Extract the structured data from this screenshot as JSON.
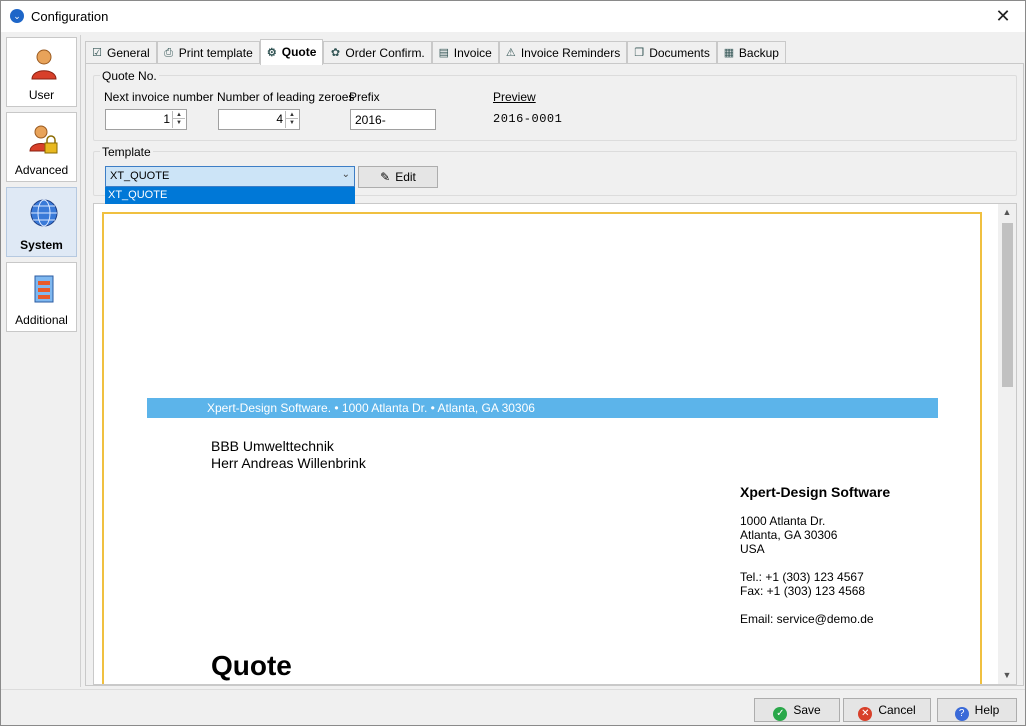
{
  "window": {
    "title": "Configuration",
    "close_glyph": "✕"
  },
  "nav": [
    {
      "label": "User",
      "icon": "user-icon"
    },
    {
      "label": "Advanced",
      "icon": "advanced-user-lock-icon"
    },
    {
      "label": "System",
      "icon": "globe-icon",
      "active": true
    },
    {
      "label": "Additional",
      "icon": "database-icon"
    }
  ],
  "tabs": [
    {
      "label": "General",
      "icon": "checklist-icon"
    },
    {
      "label": "Print template",
      "icon": "printer-icon"
    },
    {
      "label": "Quote",
      "icon": "quote-icon",
      "active": true
    },
    {
      "label": "Order Confirm.",
      "icon": "order-confirm-icon"
    },
    {
      "label": "Invoice",
      "icon": "invoice-icon"
    },
    {
      "label": "Invoice Reminders",
      "icon": "invoice-reminder-icon"
    },
    {
      "label": "Documents",
      "icon": "documents-icon"
    },
    {
      "label": "Backup",
      "icon": "backup-icon"
    }
  ],
  "quote_no": {
    "group_title": "Quote No.",
    "next_number_label": "Next invoice number",
    "next_number_value": "1",
    "leading_zeroes_label": "Number of leading zeroes",
    "leading_zeroes_value": "4",
    "prefix_label": "Prefix",
    "prefix_value": "2016-",
    "preview_label": "Preview",
    "preview_value": "2016-0001"
  },
  "template": {
    "group_title": "Template",
    "selected": "XT_QUOTE",
    "options": [
      "XT_QUOTE"
    ],
    "edit_label": "Edit"
  },
  "document": {
    "address_band": "Xpert-Design Software. • 1000 Atlanta Dr. • Atlanta, GA 30306",
    "recipient_line1": "BBB Umwelttechnik",
    "recipient_line2": "Herr Andreas Willenbrink",
    "sender_name": "Xpert-Design Software",
    "sender_street": "1000 Atlanta Dr.",
    "sender_city": "Atlanta, GA 30306",
    "sender_country": "USA",
    "sender_tel": "Tel.: +1 (303) 123 4567",
    "sender_fax": "Fax: +1 (303) 123 4568",
    "sender_email": "Email: service@demo.de",
    "title": "Quote",
    "band_color": "#5cb4ea",
    "page_border_color": "#f0c040"
  },
  "footer": {
    "save_label": "Save",
    "cancel_label": "Cancel",
    "help_label": "Help"
  }
}
